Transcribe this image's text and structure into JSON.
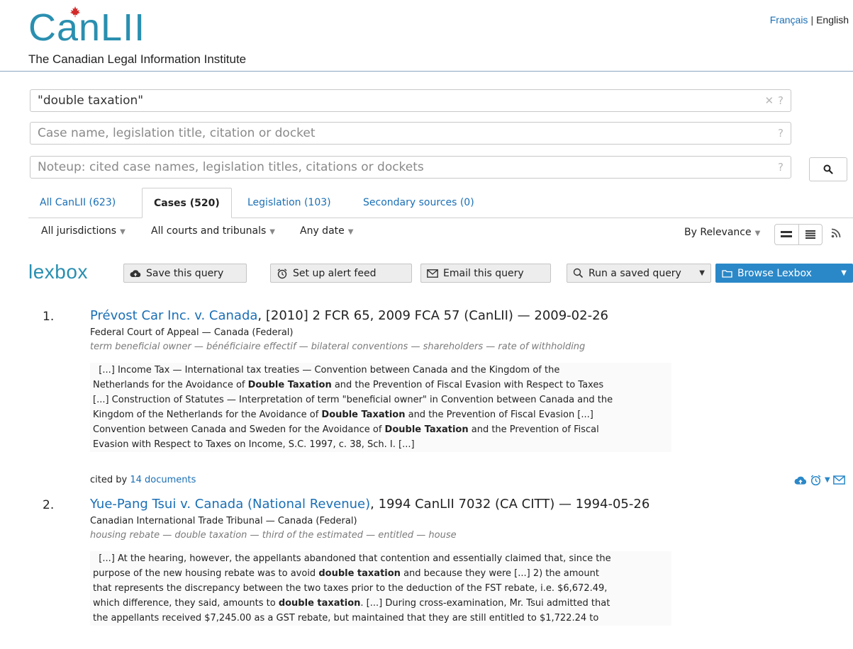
{
  "header": {
    "logo_text": "CanLII",
    "tagline": "The Canadian Legal Information Institute",
    "lang_fr": "Français",
    "lang_en": "English"
  },
  "search": {
    "query_value": "\"double taxation\"",
    "name_placeholder": "Case name, legislation title, citation or docket",
    "noteup_placeholder": "Noteup: cited case names, legislation titles, citations or dockets",
    "help": "?",
    "clear": "✕"
  },
  "tabs": [
    {
      "label": "All CanLII (623)",
      "active": false
    },
    {
      "label": "Cases (520)",
      "active": true
    },
    {
      "label": "Legislation (103)",
      "active": false
    },
    {
      "label": "Secondary sources (0)",
      "active": false
    }
  ],
  "filters": {
    "jurisdictions": "All jurisdictions",
    "courts": "All courts and tribunals",
    "date": "Any date",
    "sort": "By Relevance"
  },
  "lexbox": {
    "logo": "lexbox",
    "save": "Save this query",
    "alert": "Set up alert feed",
    "email": "Email this query",
    "run": "Run a saved query",
    "browse": "Browse Lexbox"
  },
  "results": [
    {
      "num": "1.",
      "title_link": "Prévost Car Inc. v. Canada",
      "title_rest": ", [2010] 2 FCR 65, 2009 FCA 57 (CanLII) — 2009-02-26",
      "court": "Federal Court of Appeal — Canada (Federal)",
      "keywords": "term beneficial owner — bénéficiaire effectif — bilateral conventions — shareholders — rate of withholding",
      "lines": [
        {
          "pre": "[...]  Income Tax — International tax treaties — Convention between Canada and the Kingdom of the",
          "bold": "",
          "post": ""
        },
        {
          "pre": "Netherlands for the Avoidance of ",
          "bold": "Double Taxation",
          "post": " and the Prevention of Fiscal Evasion with Respect to Taxes"
        },
        {
          "pre": "  [...]  Construction of Statutes — Interpretation of term \"beneficial owner\" in Convention between Canada and the",
          "bold": "",
          "post": ""
        },
        {
          "pre": "Kingdom of the Netherlands for the Avoidance of ",
          "bold": "Double Taxation",
          "post": " and the Prevention of Fiscal Evasion  [...]"
        },
        {
          "pre": "Convention between Canada and Sweden for the Avoidance of ",
          "bold": "Double Taxation",
          "post": " and the Prevention of Fiscal"
        },
        {
          "pre": "Evasion with Respect to Taxes on Income, S.C. 1997, c. 38, Sch. I.  [...]",
          "bold": "",
          "post": ""
        }
      ],
      "cited_prefix": "cited by ",
      "cited_link": "14 documents"
    },
    {
      "num": "2.",
      "title_link": "Yue-Pang Tsui v. Canada (National Revenue)",
      "title_rest": ", 1994 CanLII 7032 (CA CITT) — 1994-05-26",
      "court": "Canadian International Trade Tribunal — Canada (Federal)",
      "keywords": "housing rebate — double taxation — third of the estimated — entitled — house",
      "lines": [
        {
          "pre": "[...]  At the hearing, however, the appellants abandoned that contention and essentially claimed that, since the",
          "bold": "",
          "post": ""
        },
        {
          "pre": "purpose of the new housing rebate was to avoid ",
          "bold": "double taxation",
          "post": " and because they were  [...]  2) the amount"
        },
        {
          "pre": "that represents the discrepancy between the two taxes prior to the deduction of the FST rebate, i.e. $6,672.49,",
          "bold": "",
          "post": ""
        },
        {
          "pre": "which difference, they said, amounts to ",
          "bold": "double taxation",
          "post": ".  [...]  During cross-examination, Mr. Tsui admitted that"
        },
        {
          "pre": "the appellants received $7,245.00 as a GST rebate, but maintained that they are still entitled to $1,722.24 to",
          "bold": "",
          "post": ""
        }
      ]
    }
  ],
  "colors": {
    "brand": "#2a8fb0",
    "link": "#1a6fb5",
    "lexbox_button": "#2a88c8"
  }
}
